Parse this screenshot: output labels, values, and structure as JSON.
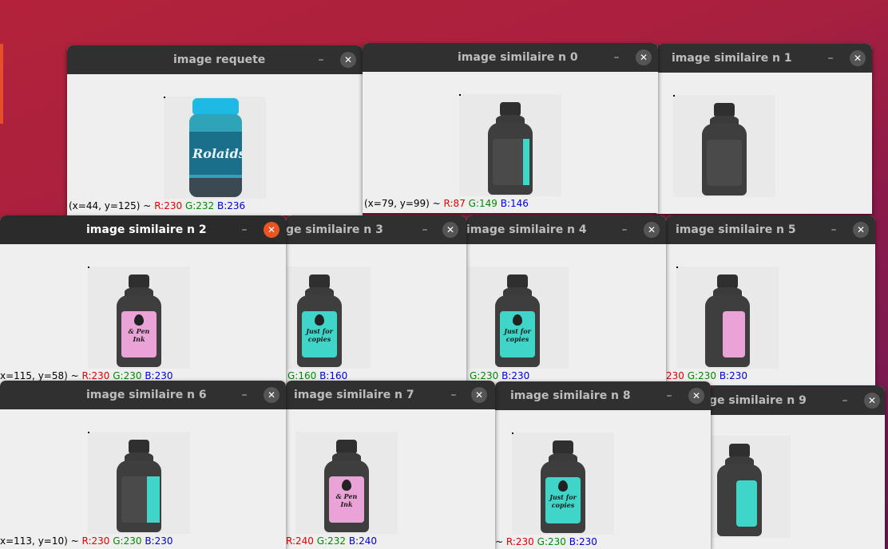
{
  "windows": {
    "w_req": {
      "title": "image requete",
      "status": {
        "coord": "(x=44, y=125) ~",
        "r": "R:230",
        "g": "G:232",
        "b": "B:236"
      }
    },
    "w0": {
      "title": "image similaire n 0",
      "status": {
        "coord": "(x=79, y=99) ~",
        "r": "R:87",
        "g": "G:149",
        "b": "B:146"
      }
    },
    "w1": {
      "title": "image similaire n 1"
    },
    "w2": {
      "title": "image similaire n 2",
      "status": {
        "coord": "x=115, y=58) ~",
        "r": "R:230",
        "g": "G:230",
        "b": "B:230"
      }
    },
    "w3": {
      "title": "ge similaire n 3",
      "status": {
        "g": "G:160",
        "b": "B:160"
      }
    },
    "w4": {
      "title": "image similaire n 4",
      "status": {
        "g": "G:230",
        "b": "B:230"
      }
    },
    "w5": {
      "title": "image similaire n 5",
      "status": {
        "r": "230",
        "g": "G:230",
        "b": "B:230"
      }
    },
    "w6": {
      "title": "image similaire n 6",
      "status": {
        "coord": "x=113, y=10) ~",
        "r": "R:230",
        "g": "G:230",
        "b": "B:230"
      }
    },
    "w7": {
      "title": "image similaire n 7",
      "status": {
        "r": "R:240",
        "g": "G:232",
        "b": "B:240"
      }
    },
    "w8": {
      "title": "image similaire n 8",
      "status": {
        "coord": "~",
        "r": "R:230",
        "g": "G:230",
        "b": "B:230"
      }
    },
    "w9": {
      "title": "ge similaire n 9"
    }
  },
  "buttons": {
    "minimize": "–",
    "close": "✕"
  },
  "labels": {
    "rolaids": "Rolaids",
    "ink": "Just for copies",
    "pen": "& Pen Ink"
  },
  "colors": {
    "desktop": "#b3223a",
    "titlebar": "#303030",
    "close_active": "#e95420",
    "label_pink": "#e9a3d6",
    "label_cyan": "#3fd6c9"
  }
}
